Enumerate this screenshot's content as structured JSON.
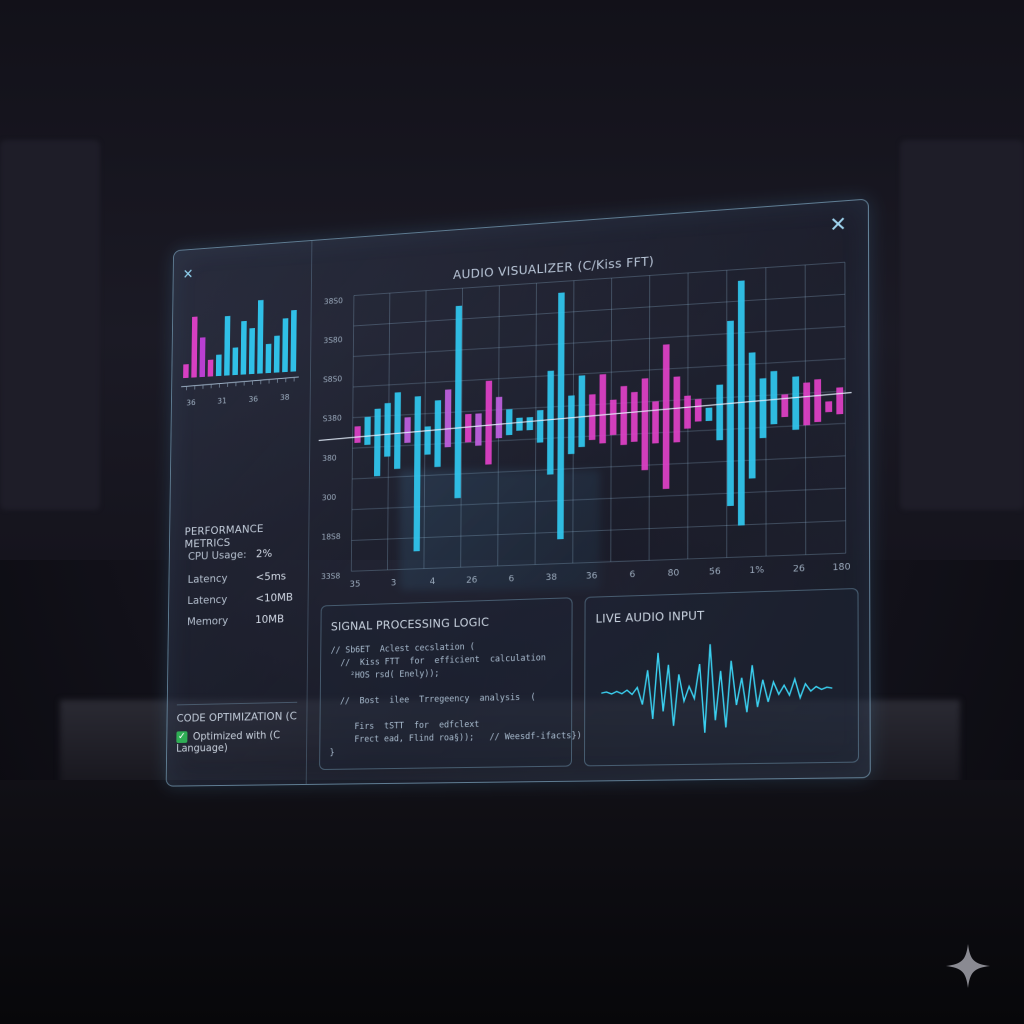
{
  "window": {
    "title": "AUDIO VISUALIZER (C/Kiss FFT)",
    "close_icon": "close-icon"
  },
  "left_panel": {
    "close_icon": "close-icon",
    "mini_chart": {
      "tick_labels": [
        "36",
        "31",
        "36",
        "38"
      ],
      "bars": [
        {
          "value": 0.18,
          "color": "#e040c8"
        },
        {
          "value": 0.8,
          "color": "#e040c8"
        },
        {
          "value": 0.52,
          "color": "#c040d8"
        },
        {
          "value": 0.22,
          "color": "#e040c8"
        },
        {
          "value": 0.28,
          "color": "#30c8f0"
        },
        {
          "value": 0.78,
          "color": "#30c8f0"
        },
        {
          "value": 0.36,
          "color": "#30c8f0"
        },
        {
          "value": 0.7,
          "color": "#30c8f0"
        },
        {
          "value": 0.6,
          "color": "#30c8f0"
        },
        {
          "value": 0.96,
          "color": "#30c8f0"
        },
        {
          "value": 0.38,
          "color": "#30c8f0"
        },
        {
          "value": 0.48,
          "color": "#30c8f0"
        },
        {
          "value": 0.7,
          "color": "#30c8f0"
        },
        {
          "value": 0.8,
          "color": "#30c8f0"
        }
      ]
    },
    "performance": {
      "title": "PERFORMANCE METRICS",
      "rows": [
        {
          "label": "CPU Usage:",
          "value": "2%"
        },
        {
          "label": "Latency",
          "value": "<5ms"
        },
        {
          "label": "Latency",
          "value": "<10MB"
        },
        {
          "label": "Memory",
          "value": "10MB"
        }
      ]
    },
    "code_optimization": {
      "title": "CODE OPTIMIZATION (C",
      "status": "Optimized with (C Language)"
    }
  },
  "chart_data": {
    "type": "bar",
    "title": "AUDIO VISUALIZER (C/Kiss FFT)",
    "y_tick_labels": [
      "38S0",
      "3S80",
      "S8S0",
      "S380",
      "380",
      "300",
      "18S8",
      "33S8"
    ],
    "x_tick_labels": [
      "35",
      "3",
      "4",
      "26",
      "6",
      "38",
      "36",
      "6",
      "80",
      "56",
      "1%",
      "26",
      "180"
    ],
    "grid": true,
    "baseline": 0,
    "ylim": [
      -1,
      1
    ],
    "series": [
      {
        "values_top": [
          0.05,
          0.12,
          0.18,
          0.22,
          0.3,
          0.1,
          0.26,
          0.02,
          0.22,
          0.3,
          0.95,
          0.1,
          0.1,
          0.35,
          0.22,
          0.12,
          0.05,
          0.05,
          0.1,
          0.4,
          1.0,
          0.2,
          0.35,
          0.2,
          0.35,
          0.15,
          0.25,
          0.2,
          0.3,
          0.12,
          0.55,
          0.3,
          0.15,
          0.12,
          0.05,
          0.22,
          0.7,
          1.0,
          0.45,
          0.25,
          0.3,
          0.12,
          0.25,
          0.2,
          0.22,
          0.05,
          0.15
        ],
        "values_bottom": [
          -0.08,
          -0.1,
          -0.35,
          -0.2,
          -0.3,
          -0.1,
          -0.95,
          -0.2,
          -0.3,
          -0.15,
          -0.55,
          -0.12,
          -0.15,
          -0.3,
          -0.1,
          -0.08,
          -0.05,
          -0.05,
          -0.15,
          -0.4,
          -0.9,
          -0.25,
          -0.2,
          -0.15,
          -0.18,
          -0.12,
          -0.2,
          -0.18,
          -0.4,
          -0.2,
          -0.55,
          -0.2,
          -0.1,
          -0.05,
          -0.05,
          -0.2,
          -0.7,
          -0.85,
          -0.5,
          -0.2,
          -0.1,
          -0.05,
          -0.15,
          -0.12,
          -0.1,
          -0.03,
          -0.05
        ],
        "colors": [
          "#e040c8",
          "#30c8f0",
          "#30c8f0",
          "#30c8f0",
          "#30c8f0",
          "#c060e0",
          "#30c8f0",
          "#30c8f0",
          "#30c8f0",
          "#c060e0",
          "#30c8f0",
          "#e040c8",
          "#c060e0",
          "#e040c8",
          "#c060e0",
          "#30c8f0",
          "#30c8f0",
          "#30c8f0",
          "#30c8f0",
          "#30c8f0",
          "#30c8f0",
          "#30c8f0",
          "#30c8f0",
          "#e040c8",
          "#e040c8",
          "#e040c8",
          "#e040c8",
          "#e040c8",
          "#e040c8",
          "#e040c8",
          "#e040c8",
          "#e040c8",
          "#e040c8",
          "#e040c8",
          "#30c8f0",
          "#30c8f0",
          "#30c8f0",
          "#30c8f0",
          "#30c8f0",
          "#30c8f0",
          "#30c8f0",
          "#e040c8",
          "#30c8f0",
          "#e040c8",
          "#e040c8",
          "#e040c8",
          "#e040c8"
        ]
      }
    ]
  },
  "signal_panel": {
    "title": "SIGNAL PROCESSING LOGIC",
    "code_lines": [
      "// Sb6ET  Aclest cecslation (",
      "  //  Kiss FTT  for  efficient  calculation",
      "    ²HOS rsd( Enely));",
      "",
      "  //  Bost  ilee  Trregeency  analysis  (",
      "",
      "     Firs  tSTT  for  edfclext",
      "     Frect ead, Flind roa§));   // Weesdf-ifacts})",
      "}"
    ]
  },
  "live_panel": {
    "title": "LIVE AUDIO INPUT",
    "waveform": [
      0,
      0.02,
      -0.02,
      0.03,
      -0.02,
      0.05,
      -0.04,
      0.1,
      -0.25,
      0.45,
      -0.55,
      0.8,
      -0.4,
      0.55,
      -0.7,
      0.35,
      -0.2,
      0.1,
      -0.15,
      0.55,
      -0.85,
      0.95,
      -0.6,
      0.4,
      -0.75,
      0.6,
      -0.3,
      0.25,
      -0.45,
      0.5,
      -0.35,
      0.2,
      -0.25,
      0.15,
      -0.1,
      0.08,
      -0.12,
      0.2,
      -0.18,
      0.1,
      -0.05,
      0.04,
      -0.02,
      0.02,
      0
    ],
    "color": "#3ad0f0"
  },
  "colors": {
    "accent_cyan": "#30c8f0",
    "accent_pink": "#e040c8",
    "check_green": "#2fae55"
  }
}
